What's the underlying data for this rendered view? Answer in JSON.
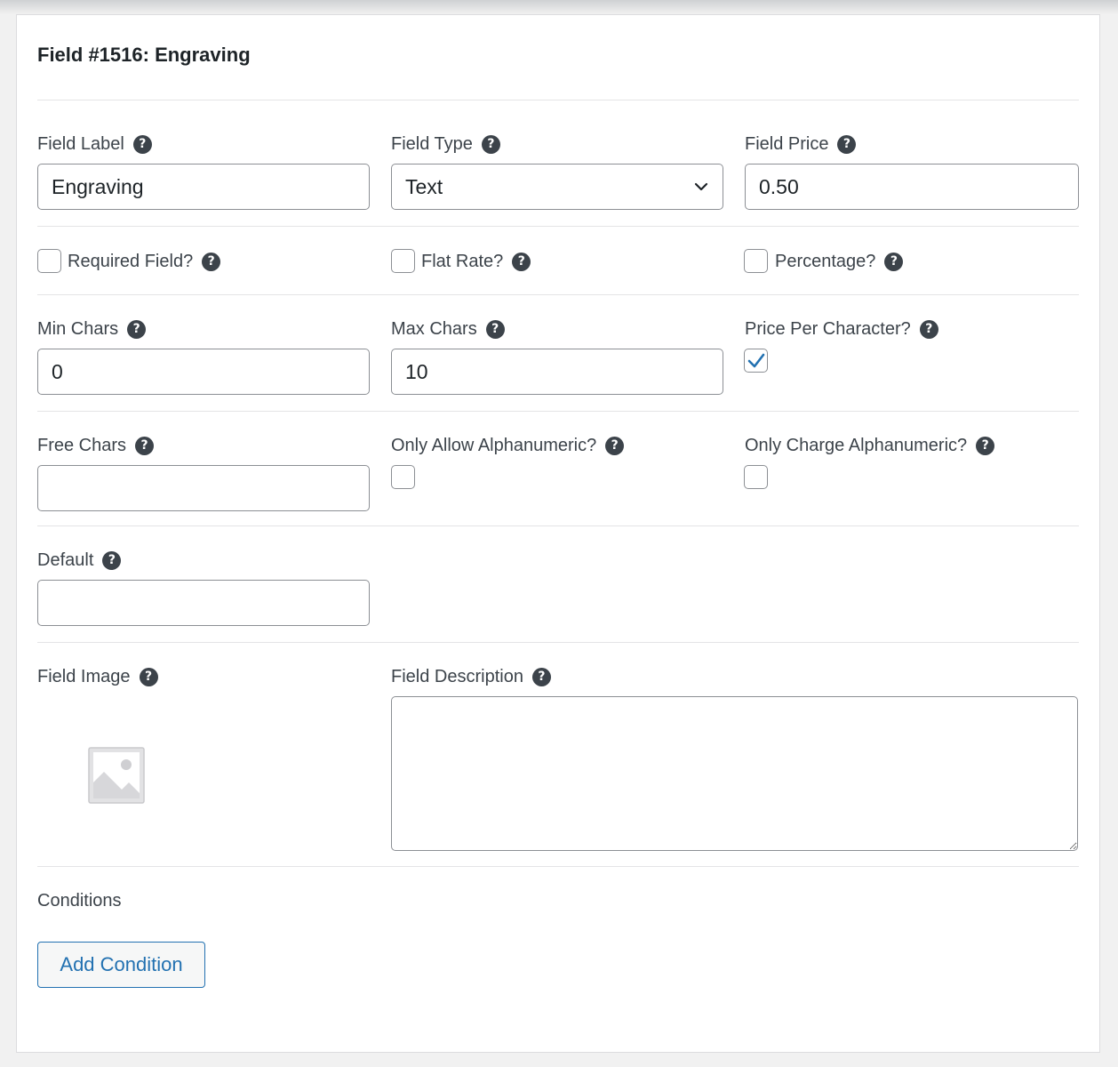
{
  "field": {
    "title": "Field #1516: Engraving"
  },
  "labels": {
    "field_label": "Field Label",
    "field_type": "Field Type",
    "field_price": "Field Price",
    "required_field": "Required Field?",
    "flat_rate": "Flat Rate?",
    "percentage": "Percentage?",
    "min_chars": "Min Chars",
    "max_chars": "Max Chars",
    "price_per_character": "Price Per Character?",
    "free_chars": "Free Chars",
    "only_allow_alphanumeric": "Only Allow Alphanumeric?",
    "only_charge_alphanumeric": "Only Charge Alphanumeric?",
    "default": "Default",
    "field_image": "Field Image",
    "field_description": "Field Description",
    "conditions": "Conditions"
  },
  "values": {
    "field_label": "Engraving",
    "field_type": "Text",
    "field_price": "0.50",
    "min_chars": "0",
    "max_chars": "10",
    "free_chars": "",
    "default": "",
    "field_description": ""
  },
  "checkboxes": {
    "required_field": false,
    "flat_rate": false,
    "percentage": false,
    "price_per_character": true,
    "only_allow_alphanumeric": false,
    "only_charge_alphanumeric": false
  },
  "help_glyph": "?",
  "buttons": {
    "add_condition": "Add Condition"
  },
  "colors": {
    "accent": "#2271b1",
    "help_icon_bg": "#3c434a",
    "border": "#8c8f94"
  },
  "icons": {
    "help": "question-circle-icon",
    "select": "chevron-down-icon",
    "image_placeholder": "image-placeholder-icon",
    "check": "checkmark-icon"
  }
}
